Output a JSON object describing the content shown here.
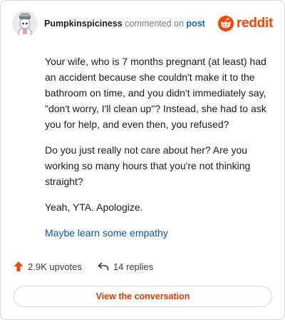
{
  "header": {
    "username": "Pumpkinspiciness",
    "action": "commented on",
    "post_link": "post",
    "logo_text": "reddit"
  },
  "comment": {
    "paragraphs": [
      "Your wife, who is 7 months pregnant (at least) had an accident because she couldn't make it to the bathroom on time, and you didn't immediately say, \"don't worry, I'll clean up\"? Instead, she had to ask you for help, and even then, you refused?",
      "Do you just really not care about her? Are you working so many hours that you're not thinking straight?",
      "Yeah, YTA. Apologize."
    ],
    "link_text": "Maybe learn some empathy"
  },
  "stats": {
    "upvotes": "2.9K upvotes",
    "replies": "14 replies"
  },
  "cta": {
    "label": "View the conversation"
  },
  "colors": {
    "brand": "#ff4500",
    "link": "#0b55a5",
    "cta_text": "#d93a00"
  }
}
